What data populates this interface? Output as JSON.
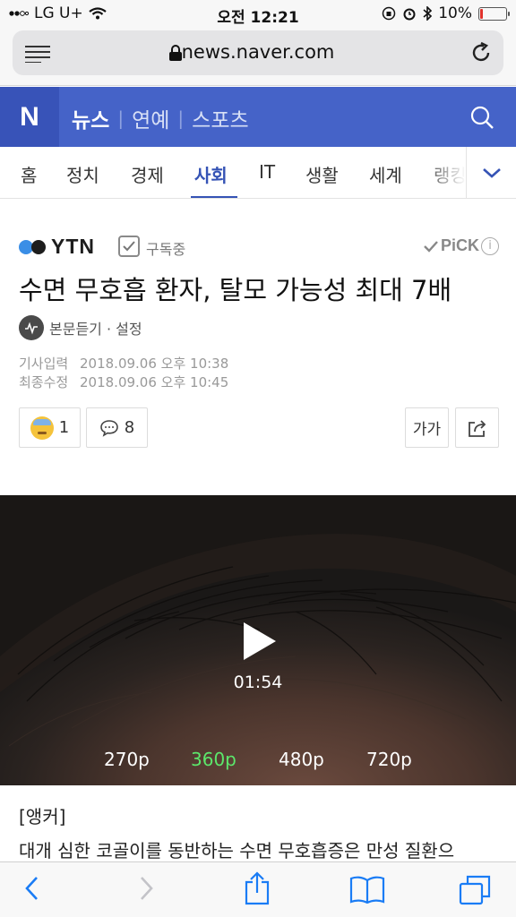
{
  "status_bar": {
    "carrier": "LG U+",
    "time": "오전 12:21",
    "battery": "10%",
    "battery_level": 0.1
  },
  "browser": {
    "url": "news.naver.com"
  },
  "naver_header": {
    "logo": "N",
    "tabs": [
      {
        "label": "뉴스",
        "active": true
      },
      {
        "label": "연예",
        "active": false
      },
      {
        "label": "스포츠",
        "active": false
      }
    ]
  },
  "categories": [
    {
      "label": "홈",
      "active": false
    },
    {
      "label": "정치",
      "active": false
    },
    {
      "label": "경제",
      "active": false
    },
    {
      "label": "사회",
      "active": true
    },
    {
      "label": "IT",
      "active": false
    },
    {
      "label": "생활",
      "active": false
    },
    {
      "label": "세계",
      "active": false
    },
    {
      "label": "랭킹",
      "active": false
    }
  ],
  "article": {
    "press": "YTN",
    "subscribe_label": "구독중",
    "pick_label": "PiCK",
    "info_glyph": "i",
    "title": "수면 무호흡 환자, 탈모 가능성 최대 7배",
    "listen_label": "본문듣기 · 설정",
    "dates": [
      {
        "label": "기사입력",
        "value": "2018.09.06 오후 10:38"
      },
      {
        "label": "최종수정",
        "value": "2018.09.06 오후 10:45"
      }
    ],
    "reaction_count": "1",
    "comment_count": "8",
    "font_button_label": "가가",
    "video": {
      "duration": "01:54",
      "qualities": [
        {
          "label": "270p",
          "selected": false
        },
        {
          "label": "360p",
          "selected": true
        },
        {
          "label": "480p",
          "selected": false
        },
        {
          "label": "720p",
          "selected": false
        }
      ]
    },
    "body_lines": [
      "[앵커]",
      "대개 심한 코골이를 동반하는 수면 무호흡증은 만성 질환으"
    ]
  },
  "colors": {
    "naver_blue": "#4563c8",
    "active_category": "#3553b5",
    "selected_quality": "#5ce76b",
    "ios_blue": "#1a7cf5"
  }
}
